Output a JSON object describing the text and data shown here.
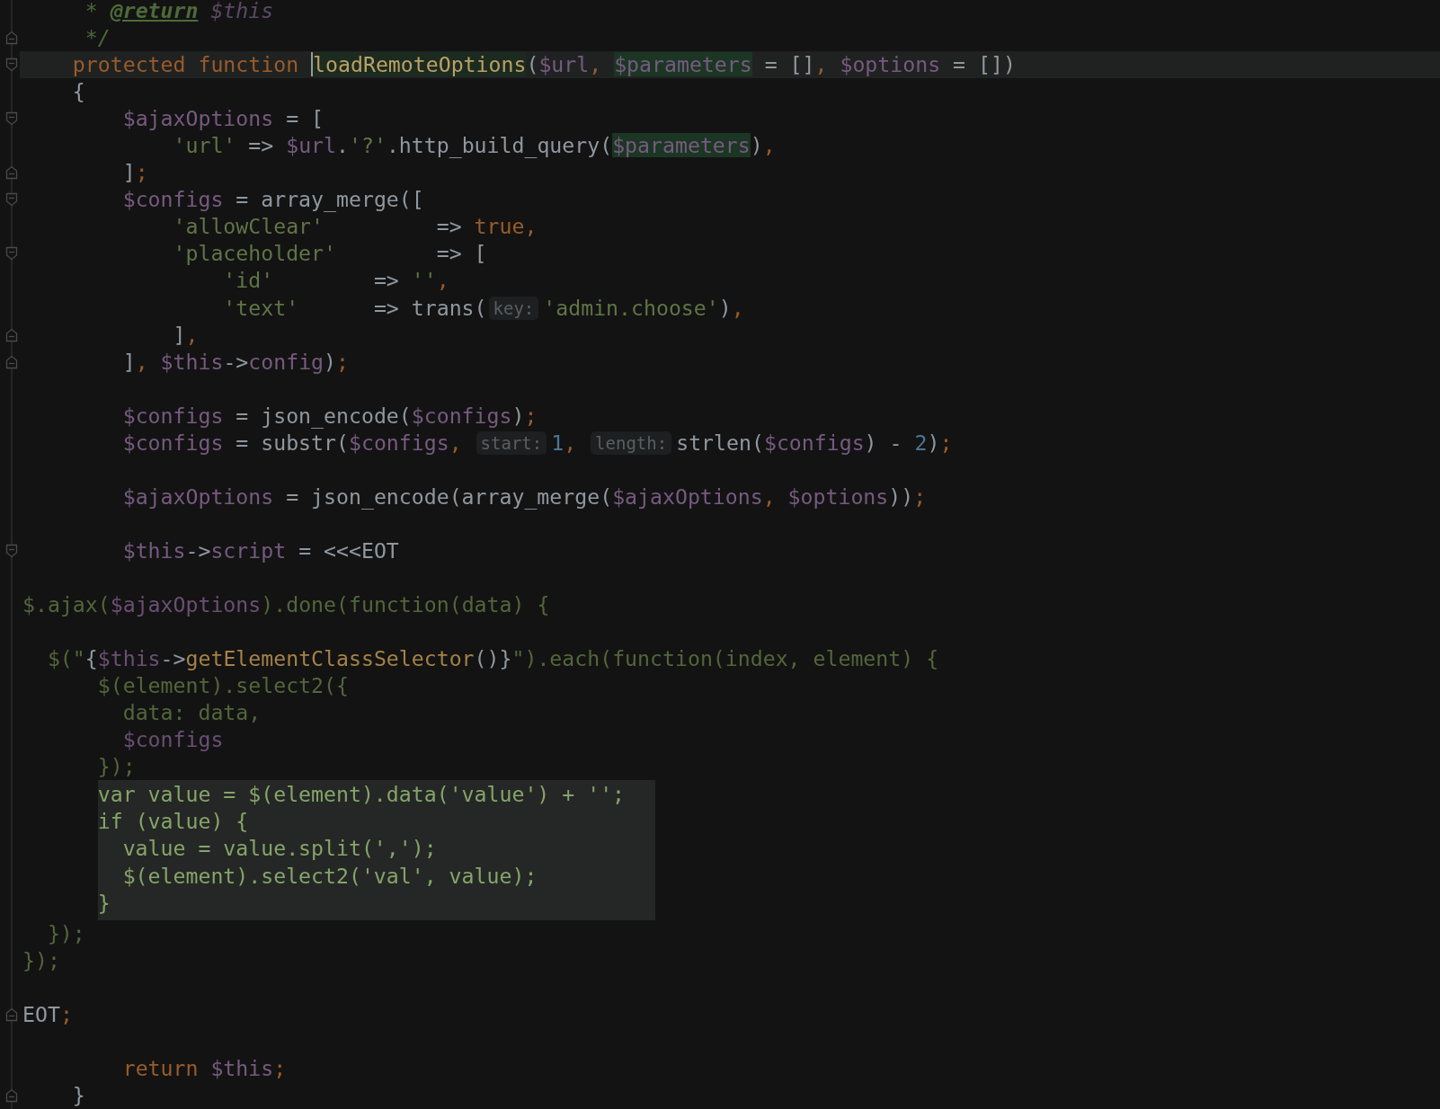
{
  "editor": {
    "lines": [
      {
        "current": false,
        "injected": false,
        "tokens": [
          {
            "text": "     * ",
            "kind": "comment"
          },
          {
            "text": "@return",
            "kind": "doc-tag"
          },
          {
            "text": " $this",
            "kind": "comment-var"
          }
        ]
      },
      {
        "current": false,
        "injected": false,
        "fold": {
          "kind": "end"
        },
        "tokens": [
          {
            "text": "     */",
            "kind": "comment"
          }
        ]
      },
      {
        "current": true,
        "injected": false,
        "fold": {
          "kind": "start"
        },
        "tokens": [
          {
            "text": "    protected function ",
            "kind": "keyword"
          },
          {
            "text": "loadRemoteOptions",
            "kind": "name"
          },
          {
            "text": "(",
            "kind": "plain"
          },
          {
            "text": "$url",
            "kind": "var"
          },
          {
            "text": ", ",
            "kind": "punct"
          },
          {
            "text": "$parameters",
            "kind": "var-hit"
          },
          {
            "text": " = []",
            "kind": "plain"
          },
          {
            "text": ", ",
            "kind": "punct"
          },
          {
            "text": "$options",
            "kind": "var"
          },
          {
            "text": " = [])",
            "kind": "plain"
          }
        ]
      },
      {
        "current": false,
        "injected": false,
        "tokens": [
          {
            "text": "    {",
            "kind": "plain"
          }
        ]
      },
      {
        "current": false,
        "injected": false,
        "fold": {
          "kind": "start"
        },
        "tokens": [
          {
            "text": "        $ajaxOptions",
            "kind": "var"
          },
          {
            "text": " = [",
            "kind": "plain"
          }
        ]
      },
      {
        "current": false,
        "injected": false,
        "tokens": [
          {
            "text": "            'url'",
            "kind": "string"
          },
          {
            "text": " => ",
            "kind": "plain"
          },
          {
            "text": "$url",
            "kind": "var"
          },
          {
            "text": ".",
            "kind": "plain"
          },
          {
            "text": "'?'",
            "kind": "string"
          },
          {
            "text": ".http_build_query(",
            "kind": "plain"
          },
          {
            "text": "$parameters",
            "kind": "var-hit"
          },
          {
            "text": ")",
            "kind": "plain"
          },
          {
            "text": ",",
            "kind": "punct"
          }
        ]
      },
      {
        "current": false,
        "injected": false,
        "fold": {
          "kind": "end"
        },
        "tokens": [
          {
            "text": "        ]",
            "kind": "plain"
          },
          {
            "text": ";",
            "kind": "punct"
          }
        ]
      },
      {
        "current": false,
        "injected": false,
        "fold": {
          "kind": "start"
        },
        "tokens": [
          {
            "text": "        $configs",
            "kind": "var"
          },
          {
            "text": " = array_merge([",
            "kind": "plain"
          }
        ]
      },
      {
        "current": false,
        "injected": false,
        "tokens": [
          {
            "text": "            'allowClear'",
            "kind": "string"
          },
          {
            "text": "         => ",
            "kind": "plain"
          },
          {
            "text": "true",
            "kind": "keyword"
          },
          {
            "text": ",",
            "kind": "punct"
          }
        ]
      },
      {
        "current": false,
        "injected": false,
        "fold": {
          "kind": "start"
        },
        "tokens": [
          {
            "text": "            'placeholder'",
            "kind": "string"
          },
          {
            "text": "        => [",
            "kind": "plain"
          }
        ]
      },
      {
        "current": false,
        "injected": false,
        "tokens": [
          {
            "text": "                'id'",
            "kind": "string"
          },
          {
            "text": "        => ",
            "kind": "plain"
          },
          {
            "text": "''",
            "kind": "string"
          },
          {
            "text": ",",
            "kind": "punct"
          }
        ]
      },
      {
        "current": false,
        "injected": false,
        "tokens": [
          {
            "text": "                'text'",
            "kind": "string"
          },
          {
            "text": "      => trans(",
            "kind": "plain"
          },
          {
            "text": "key:",
            "kind": "hint"
          },
          {
            "text": "'admin.choose'",
            "kind": "string"
          },
          {
            "text": ")",
            "kind": "plain"
          },
          {
            "text": ",",
            "kind": "punct"
          }
        ]
      },
      {
        "current": false,
        "injected": false,
        "fold": {
          "kind": "end"
        },
        "tokens": [
          {
            "text": "            ]",
            "kind": "plain"
          },
          {
            "text": ",",
            "kind": "punct"
          }
        ]
      },
      {
        "current": false,
        "injected": false,
        "fold": {
          "kind": "end"
        },
        "tokens": [
          {
            "text": "        ]",
            "kind": "plain"
          },
          {
            "text": ", ",
            "kind": "punct"
          },
          {
            "text": "$this",
            "kind": "var"
          },
          {
            "text": "->",
            "kind": "plain"
          },
          {
            "text": "config",
            "kind": "var"
          },
          {
            "text": ")",
            "kind": "plain"
          },
          {
            "text": ";",
            "kind": "punct"
          }
        ]
      },
      {
        "current": false,
        "injected": false
      },
      {
        "current": false,
        "injected": false,
        "tokens": [
          {
            "text": "        $configs",
            "kind": "var"
          },
          {
            "text": " = json_encode(",
            "kind": "plain"
          },
          {
            "text": "$configs",
            "kind": "var"
          },
          {
            "text": ")",
            "kind": "plain"
          },
          {
            "text": ";",
            "kind": "punct"
          }
        ]
      },
      {
        "current": false,
        "injected": false,
        "tokens": [
          {
            "text": "        $configs",
            "kind": "var"
          },
          {
            "text": " = substr(",
            "kind": "plain"
          },
          {
            "text": "$configs",
            "kind": "var"
          },
          {
            "text": ", ",
            "kind": "punct"
          },
          {
            "text": "start:",
            "kind": "hint"
          },
          {
            "text": "1",
            "kind": "number"
          },
          {
            "text": ", ",
            "kind": "punct"
          },
          {
            "text": "length:",
            "kind": "hint"
          },
          {
            "text": "strlen(",
            "kind": "plain"
          },
          {
            "text": "$configs",
            "kind": "var"
          },
          {
            "text": ") - ",
            "kind": "plain"
          },
          {
            "text": "2",
            "kind": "number"
          },
          {
            "text": ")",
            "kind": "plain"
          },
          {
            "text": ";",
            "kind": "punct"
          }
        ]
      },
      {
        "current": false,
        "injected": false
      },
      {
        "current": false,
        "injected": false,
        "tokens": [
          {
            "text": "        $ajaxOptions",
            "kind": "var"
          },
          {
            "text": " = json_encode(array_merge(",
            "kind": "plain"
          },
          {
            "text": "$ajaxOptions",
            "kind": "var"
          },
          {
            "text": ", ",
            "kind": "punct"
          },
          {
            "text": "$options",
            "kind": "var"
          },
          {
            "text": "))",
            "kind": "plain"
          },
          {
            "text": ";",
            "kind": "punct"
          }
        ]
      },
      {
        "current": false,
        "injected": false
      },
      {
        "current": false,
        "injected": false,
        "fold": {
          "kind": "start"
        },
        "tokens": [
          {
            "text": "        $this",
            "kind": "var"
          },
          {
            "text": "->",
            "kind": "plain"
          },
          {
            "text": "script",
            "kind": "var"
          },
          {
            "text": " = <<<EOT",
            "kind": "plain"
          }
        ]
      },
      {
        "current": false,
        "injected": false
      },
      {
        "current": false,
        "injected": false,
        "tokens": [
          {
            "text": "$.ajax(",
            "kind": "js"
          },
          {
            "text": "$ajaxOptions",
            "kind": "js-var"
          },
          {
            "text": ").done(function(data) {",
            "kind": "js"
          }
        ]
      },
      {
        "current": false,
        "injected": false
      },
      {
        "current": false,
        "injected": false,
        "tokens": [
          {
            "text": "  $(\"",
            "kind": "js"
          },
          {
            "text": "{",
            "kind": "plain"
          },
          {
            "text": "$this",
            "kind": "js-var"
          },
          {
            "text": "->",
            "kind": "plain"
          },
          {
            "text": "getElementClassSelector",
            "kind": "js-method"
          },
          {
            "text": "()",
            "kind": "plain"
          },
          {
            "text": "}",
            "kind": "plain"
          },
          {
            "text": "\").each(function(index, element) {",
            "kind": "js"
          }
        ]
      },
      {
        "current": false,
        "injected": false,
        "tokens": [
          {
            "text": "      $(element).select2({",
            "kind": "js"
          }
        ]
      },
      {
        "current": false,
        "injected": false,
        "tokens": [
          {
            "text": "        data: data,",
            "kind": "js"
          }
        ]
      },
      {
        "current": false,
        "injected": false,
        "tokens": [
          {
            "text": "        $configs",
            "kind": "js-var"
          }
        ]
      },
      {
        "current": false,
        "injected": false,
        "tokens": [
          {
            "text": "      });",
            "kind": "js"
          }
        ]
      },
      {
        "current": false,
        "injected": true,
        "tokens": [
          {
            "text": "      var value = $(element).data('value') + '';",
            "kind": "inject"
          }
        ]
      },
      {
        "current": false,
        "injected": true,
        "tokens": [
          {
            "text": "      if (value) {",
            "kind": "inject"
          }
        ]
      },
      {
        "current": false,
        "injected": true,
        "tokens": [
          {
            "text": "        value = value.split(',');",
            "kind": "inject"
          }
        ]
      },
      {
        "current": false,
        "injected": true,
        "tokens": [
          {
            "text": "        $(element).select2('val', value);",
            "kind": "inject"
          }
        ]
      },
      {
        "current": false,
        "injected": true,
        "tokens": [
          {
            "text": "      }",
            "kind": "inject"
          }
        ]
      },
      {
        "current": false,
        "injected": false,
        "tokens": [
          {
            "text": "  });",
            "kind": "js"
          }
        ]
      },
      {
        "current": false,
        "injected": false,
        "tokens": [
          {
            "text": "});",
            "kind": "js"
          }
        ]
      },
      {
        "current": false,
        "injected": false
      },
      {
        "current": false,
        "injected": false,
        "fold": {
          "kind": "end"
        },
        "tokens": [
          {
            "text": "EOT",
            "kind": "plain"
          },
          {
            "text": ";",
            "kind": "punct"
          }
        ]
      },
      {
        "current": false,
        "injected": false
      },
      {
        "current": false,
        "injected": false,
        "tokens": [
          {
            "text": "        return ",
            "kind": "keyword"
          },
          {
            "text": "$this",
            "kind": "var"
          },
          {
            "text": ";",
            "kind": "punct"
          }
        ]
      },
      {
        "current": false,
        "injected": false,
        "fold": {
          "kind": "end"
        },
        "tokens": [
          {
            "text": "    }",
            "kind": "plain"
          }
        ]
      }
    ]
  }
}
